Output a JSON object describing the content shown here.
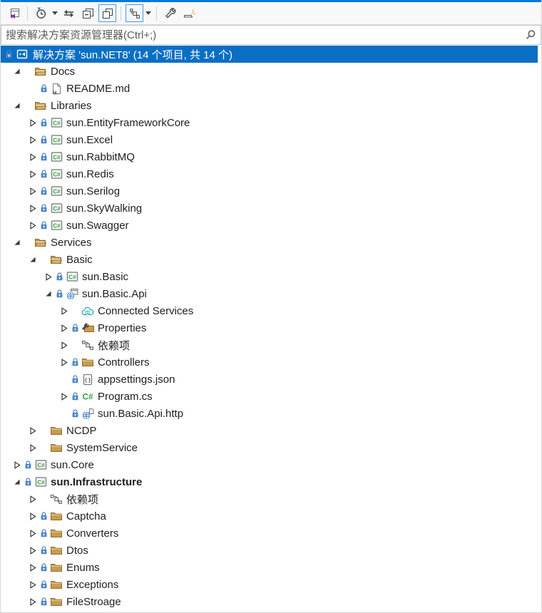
{
  "colors": {
    "accent_top": "#0079d8",
    "selection": "#0a6fc4",
    "toolbar_bg": "#f8f8f8",
    "folder": "#c99b4e",
    "lock_blue": "#4e86c6",
    "csharp_green": "#2f9e44",
    "globe_blue": "#2e76c9",
    "teal": "#2ba5a0",
    "vs_purple": "#7b3a96"
  },
  "toolbar": {
    "groups": [
      [
        {
          "name": "switch-views",
          "icon": "vs-window"
        }
      ],
      [
        {
          "name": "pending-changes-filter",
          "icon": "clock-filter",
          "caret": true
        },
        {
          "name": "sync-with-active-document",
          "icon": "sync-arrows"
        },
        {
          "name": "collapse-all",
          "icon": "collapse-all"
        },
        {
          "name": "show-all-files",
          "icon": "overlap-windows",
          "toggled": true
        }
      ],
      [
        {
          "name": "file-nesting",
          "icon": "hierarchy",
          "caret": true,
          "toggled": true
        }
      ],
      [
        {
          "name": "properties",
          "icon": "wrench"
        },
        {
          "name": "preview-selected-items",
          "icon": "preview-sparkle"
        }
      ]
    ]
  },
  "search": {
    "placeholder": "搜索解决方案资源管理器(Ctrl+;)"
  },
  "tree": {
    "rows": [
      {
        "label": "解决方案 'sun.NET8' (14 个项目, 共 14 个)",
        "level": 0,
        "arrow": "none",
        "lock": true,
        "icon": "vs-solution",
        "selected": true
      },
      {
        "label": "Docs",
        "level": 1,
        "arrow": "open",
        "lock": false,
        "icon": "folder-open"
      },
      {
        "label": "README.md",
        "level": 2,
        "arrow": "none",
        "lock": true,
        "icon": "md-file"
      },
      {
        "label": "Libraries",
        "level": 1,
        "arrow": "open",
        "lock": false,
        "icon": "folder-open"
      },
      {
        "label": "sun.EntityFrameworkCore",
        "level": 2,
        "arrow": "closed",
        "lock": true,
        "icon": "csharp-project"
      },
      {
        "label": "sun.Excel",
        "level": 2,
        "arrow": "closed",
        "lock": true,
        "icon": "csharp-project"
      },
      {
        "label": "sun.RabbitMQ",
        "level": 2,
        "arrow": "closed",
        "lock": true,
        "icon": "csharp-project"
      },
      {
        "label": "sun.Redis",
        "level": 2,
        "arrow": "closed",
        "lock": true,
        "icon": "csharp-project"
      },
      {
        "label": "sun.Serilog",
        "level": 2,
        "arrow": "closed",
        "lock": true,
        "icon": "csharp-project"
      },
      {
        "label": "sun.SkyWalking",
        "level": 2,
        "arrow": "closed",
        "lock": true,
        "icon": "csharp-project"
      },
      {
        "label": "sun.Swagger",
        "level": 2,
        "arrow": "closed",
        "lock": true,
        "icon": "csharp-project"
      },
      {
        "label": "Services",
        "level": 1,
        "arrow": "open",
        "lock": false,
        "icon": "folder-open"
      },
      {
        "label": "Basic",
        "level": 2,
        "arrow": "open",
        "lock": false,
        "icon": "folder-open"
      },
      {
        "label": "sun.Basic",
        "level": 3,
        "arrow": "closed",
        "lock": true,
        "icon": "csharp-project"
      },
      {
        "label": "sun.Basic.Api",
        "level": 3,
        "arrow": "open",
        "lock": true,
        "icon": "web-project"
      },
      {
        "label": "Connected Services",
        "level": 4,
        "arrow": "closed",
        "lock": false,
        "icon": "cloud-services"
      },
      {
        "label": "Properties",
        "level": 4,
        "arrow": "closed",
        "lock": true,
        "icon": "properties-folder"
      },
      {
        "label": "依赖项",
        "level": 4,
        "arrow": "closed",
        "lock": false,
        "icon": "dependencies"
      },
      {
        "label": "Controllers",
        "level": 4,
        "arrow": "closed",
        "lock": true,
        "icon": "folder-closed"
      },
      {
        "label": "appsettings.json",
        "level": 4,
        "arrow": "none",
        "lock": true,
        "icon": "json-file"
      },
      {
        "label": "Program.cs",
        "level": 4,
        "arrow": "closed",
        "lock": true,
        "icon": "cs-file"
      },
      {
        "label": "sun.Basic.Api.http",
        "level": 4,
        "arrow": "none",
        "lock": true,
        "icon": "http-file"
      },
      {
        "label": "NCDP",
        "level": 2,
        "arrow": "closed",
        "lock": false,
        "icon": "folder-closed"
      },
      {
        "label": "SystemService",
        "level": 2,
        "arrow": "closed",
        "lock": false,
        "icon": "folder-closed"
      },
      {
        "label": "sun.Core",
        "level": 1,
        "arrow": "closed",
        "lock": true,
        "icon": "csharp-project"
      },
      {
        "label": "sun.Infrastructure",
        "level": 1,
        "arrow": "open",
        "lock": true,
        "icon": "csharp-project",
        "bold": true
      },
      {
        "label": "依赖项",
        "level": 2,
        "arrow": "closed",
        "lock": false,
        "icon": "dependencies"
      },
      {
        "label": "Captcha",
        "level": 2,
        "arrow": "closed",
        "lock": true,
        "icon": "folder-closed"
      },
      {
        "label": "Converters",
        "level": 2,
        "arrow": "closed",
        "lock": true,
        "icon": "folder-closed"
      },
      {
        "label": "Dtos",
        "level": 2,
        "arrow": "closed",
        "lock": true,
        "icon": "folder-closed"
      },
      {
        "label": "Enums",
        "level": 2,
        "arrow": "closed",
        "lock": true,
        "icon": "folder-closed"
      },
      {
        "label": "Exceptions",
        "level": 2,
        "arrow": "closed",
        "lock": true,
        "icon": "folder-closed"
      },
      {
        "label": "FileStroage",
        "level": 2,
        "arrow": "closed",
        "lock": true,
        "icon": "folder-closed"
      }
    ]
  }
}
